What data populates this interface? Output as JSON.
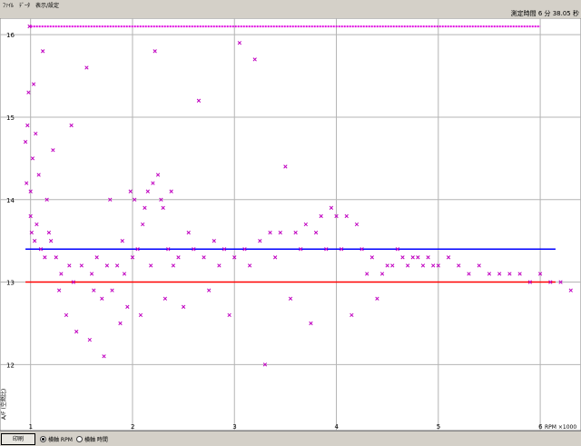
{
  "menu": {
    "items": [
      "ﾌｧｲﾙ",
      "ﾃﾞｰﾀ",
      "表示/設定"
    ]
  },
  "header": {
    "time_label": "測定時間 6 分 38.05 秒"
  },
  "status": {
    "button_label": "印刷",
    "option1": "横軸 RPM",
    "option2": "横軸 時間"
  },
  "colors": {
    "background": "#ffffff",
    "grid": "#b4b4b4",
    "points": "#c000c0",
    "upper_limit": "#0000ff",
    "lower_limit": "#ff0000",
    "top_band": "#e000e0"
  },
  "chart_data": {
    "type": "scatter",
    "xlabel": "RPM ×1000",
    "ylabel": "A/F (空燃比)",
    "xlim": [
      0.7,
      6.4
    ],
    "ylim": [
      11.2,
      16.2
    ],
    "grid": true,
    "x_ticks": [
      1,
      2,
      3,
      4,
      5,
      6
    ],
    "y_ticks": [
      12,
      13,
      14,
      15,
      16
    ],
    "reference_lines": [
      {
        "y": 13.4,
        "color": "#0000ff"
      },
      {
        "y": 13.0,
        "color": "#ff0000"
      }
    ],
    "max_band": {
      "y": 16.1,
      "x_range": [
        1.0,
        6.0
      ]
    },
    "series": [
      {
        "values": [
          [
            0.95,
            14.7
          ],
          [
            0.96,
            14.2
          ],
          [
            0.97,
            14.9
          ],
          [
            0.98,
            15.3
          ],
          [
            0.99,
            16.1
          ],
          [
            1.0,
            14.1
          ],
          [
            1.0,
            13.8
          ],
          [
            1.01,
            13.6
          ],
          [
            1.02,
            14.5
          ],
          [
            1.03,
            15.4
          ],
          [
            1.04,
            13.5
          ],
          [
            1.05,
            14.8
          ],
          [
            1.06,
            13.7
          ],
          [
            1.08,
            14.3
          ],
          [
            1.1,
            13.4
          ],
          [
            1.12,
            15.8
          ],
          [
            1.14,
            13.3
          ],
          [
            1.16,
            14.0
          ],
          [
            1.18,
            13.6
          ],
          [
            1.2,
            13.5
          ],
          [
            1.22,
            14.6
          ],
          [
            1.25,
            13.3
          ],
          [
            1.28,
            12.9
          ],
          [
            1.3,
            13.1
          ],
          [
            1.35,
            12.6
          ],
          [
            1.38,
            13.2
          ],
          [
            1.4,
            14.9
          ],
          [
            1.42,
            13.0
          ],
          [
            1.45,
            12.4
          ],
          [
            1.5,
            13.2
          ],
          [
            1.55,
            15.6
          ],
          [
            1.58,
            12.3
          ],
          [
            1.6,
            13.1
          ],
          [
            1.62,
            12.9
          ],
          [
            1.65,
            13.3
          ],
          [
            1.7,
            12.8
          ],
          [
            1.72,
            12.1
          ],
          [
            1.75,
            13.2
          ],
          [
            1.78,
            14.0
          ],
          [
            1.8,
            12.9
          ],
          [
            1.85,
            13.2
          ],
          [
            1.88,
            12.5
          ],
          [
            1.9,
            13.5
          ],
          [
            1.92,
            13.1
          ],
          [
            1.95,
            12.7
          ],
          [
            1.98,
            14.1
          ],
          [
            2.0,
            13.3
          ],
          [
            2.02,
            14.0
          ],
          [
            2.05,
            13.4
          ],
          [
            2.08,
            12.6
          ],
          [
            2.1,
            13.7
          ],
          [
            2.12,
            13.9
          ],
          [
            2.15,
            14.1
          ],
          [
            2.18,
            13.2
          ],
          [
            2.2,
            14.2
          ],
          [
            2.22,
            15.8
          ],
          [
            2.25,
            14.3
          ],
          [
            2.28,
            14.0
          ],
          [
            2.3,
            13.9
          ],
          [
            2.32,
            12.8
          ],
          [
            2.35,
            13.4
          ],
          [
            2.38,
            14.1
          ],
          [
            2.4,
            13.2
          ],
          [
            2.45,
            13.3
          ],
          [
            2.5,
            12.7
          ],
          [
            2.55,
            13.6
          ],
          [
            2.6,
            13.4
          ],
          [
            2.65,
            15.2
          ],
          [
            2.7,
            13.3
          ],
          [
            2.75,
            12.9
          ],
          [
            2.8,
            13.5
          ],
          [
            2.85,
            13.2
          ],
          [
            2.9,
            13.4
          ],
          [
            2.95,
            12.6
          ],
          [
            3.0,
            13.3
          ],
          [
            3.05,
            15.9
          ],
          [
            3.1,
            13.4
          ],
          [
            3.15,
            13.2
          ],
          [
            3.2,
            15.7
          ],
          [
            3.25,
            13.5
          ],
          [
            3.3,
            12.0
          ],
          [
            3.35,
            13.6
          ],
          [
            3.4,
            13.3
          ],
          [
            3.45,
            13.6
          ],
          [
            3.5,
            14.4
          ],
          [
            3.55,
            12.8
          ],
          [
            3.6,
            13.6
          ],
          [
            3.65,
            13.4
          ],
          [
            3.7,
            13.7
          ],
          [
            3.75,
            12.5
          ],
          [
            3.8,
            13.6
          ],
          [
            3.85,
            13.8
          ],
          [
            3.9,
            13.4
          ],
          [
            3.95,
            13.9
          ],
          [
            4.0,
            13.8
          ],
          [
            4.05,
            13.4
          ],
          [
            4.1,
            13.8
          ],
          [
            4.15,
            12.6
          ],
          [
            4.2,
            13.7
          ],
          [
            4.25,
            13.4
          ],
          [
            4.3,
            13.1
          ],
          [
            4.35,
            13.3
          ],
          [
            4.4,
            12.8
          ],
          [
            4.45,
            13.1
          ],
          [
            4.5,
            13.2
          ],
          [
            4.55,
            13.2
          ],
          [
            4.6,
            13.4
          ],
          [
            4.65,
            13.3
          ],
          [
            4.7,
            13.2
          ],
          [
            4.75,
            13.3
          ],
          [
            4.8,
            13.3
          ],
          [
            4.85,
            13.2
          ],
          [
            4.9,
            13.3
          ],
          [
            4.95,
            13.2
          ],
          [
            5.0,
            13.2
          ],
          [
            5.1,
            13.3
          ],
          [
            5.2,
            13.2
          ],
          [
            5.3,
            13.1
          ],
          [
            5.4,
            13.2
          ],
          [
            5.5,
            13.1
          ],
          [
            5.6,
            13.1
          ],
          [
            5.7,
            13.1
          ],
          [
            5.8,
            13.1
          ],
          [
            5.9,
            13.0
          ],
          [
            6.0,
            13.1
          ],
          [
            6.1,
            13.0
          ],
          [
            6.2,
            13.0
          ],
          [
            6.3,
            12.9
          ]
        ]
      }
    ]
  }
}
